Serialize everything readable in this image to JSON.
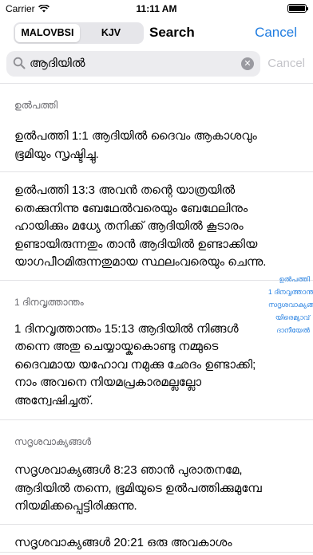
{
  "status_bar": {
    "carrier": "Carrier",
    "time": "11:11 AM"
  },
  "nav": {
    "segments": [
      "MALOVBSI",
      "KJV"
    ],
    "selected_segment": "MALOVBSI",
    "title": "Search",
    "cancel_label": "Cancel"
  },
  "search": {
    "query": "ആദിയിൽ",
    "cancel_label": "Cancel"
  },
  "results": [
    {
      "section": "ഉൽപത്തി",
      "verses": [
        {
          "text": "ഉൽപത്തി 1:1 ആദിയിൽ ദൈവം ആകാശവും ഭൂമിയും സൃഷ്ടിച്ചു."
        },
        {
          "text": "ഉൽപത്തി 13:3 അവൻ തന്റെ യാത്രയിൽ തെക്കുനിന്നു ബേഥേൽവരെയും ബേഥേലിനും ഹായിക്കും മധ്യേ തനിക്ക് ആദിയിൽ കൂടാരം ഉണ്ടായിരുന്നതും താൻ ആദിയിൽ ഉണ്ടാക്കിയ യാഗപീഠമിരുന്നതുമായ സ്ഥലംവരെയും ചെന്നു."
        }
      ]
    },
    {
      "section": "1 ദിനവൃത്താന്തം",
      "verses": [
        {
          "text": "1 ദിനവൃത്താന്തം 15:13 ആദിയിൽ നിങ്ങൾ തന്നെ അതു ചെയ്യായ്കകൊണ്ടു നമ്മുടെ ദൈവമായ യഹോവ നമുക്കു ഛേദം ഉണ്ടാക്കി; നാം അവനെ നിയമപ്രകാരമല്ലല്ലോ അന്വേഷിച്ചത്."
        }
      ]
    },
    {
      "section": "സദൃശവാക്യങ്ങൾ",
      "verses": [
        {
          "text": "സദൃശവാക്യങ്ങൾ 8:23 ഞാൻ പുരാതനമേ, ആദിയിൽ തന്നെ, ഭൂമിയുടെ ഉൽപത്തിക്കുമുമ്പേ നിയമിക്കപ്പെട്ടിരിക്കുന്നു."
        },
        {
          "text": "സദൃശവാക്യങ്ങൾ 20:21 ഒരു അവകാശം"
        }
      ]
    }
  ],
  "section_index": [
    "ഉൽപത്തി",
    "1 ദിനവൃത്താന്തം",
    "സദൃശവാക്യങ്ങൾ",
    "യിരെമ്യാവ്",
    "ദാനീയേൽ"
  ],
  "colors": {
    "accent": "#1f7ce0",
    "secondary_text": "#6b6b70",
    "search_field_bg": "#ececef"
  }
}
